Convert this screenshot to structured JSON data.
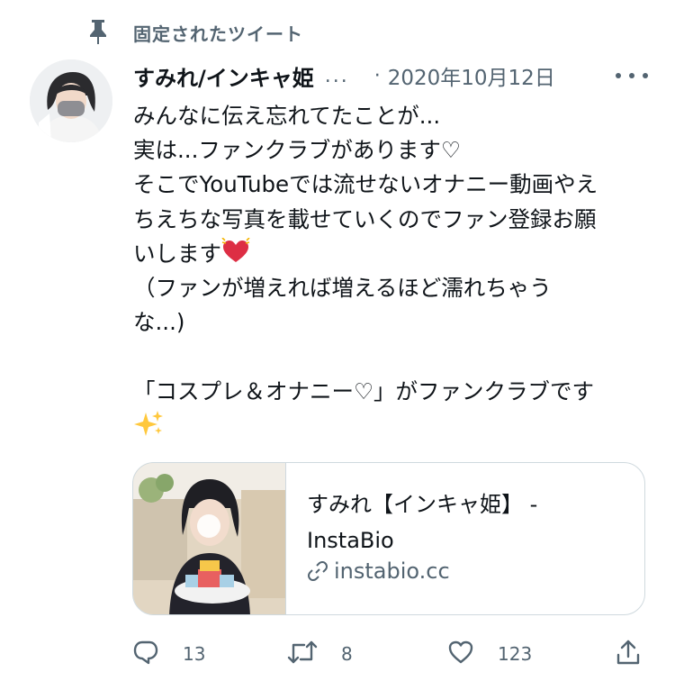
{
  "pinned": {
    "label": "固定されたツイート",
    "icon": "pin-icon"
  },
  "author": {
    "display_name": "すみれ/インキャ姫",
    "name_truncation": "...",
    "separator": "·",
    "date": "2020年10月12日"
  },
  "tweet": {
    "lines": [
      "みんなに伝え忘れてたことが...",
      "実は...ファンクラブがあります♡",
      "そこでYouTubeでは流せないオナニー動画やえ",
      "ちえちな写真を載せていくのでファン登録お願",
      "いします",
      "（ファンが増えれば増えるほど濡れちゃう",
      "な...)",
      "",
      "「コスプレ＆オナニー♡」がファンクラブです"
    ]
  },
  "card": {
    "title_line1": "すみれ【インキャ姫】 -",
    "title_line2": "InstaBio",
    "domain": "instabio.cc"
  },
  "actions": {
    "replies": "13",
    "retweets": "8",
    "likes": "123"
  },
  "colors": {
    "text": "#0f1419",
    "secondary": "#536471",
    "border": "#cfd9de",
    "heart": "#e0245e"
  }
}
